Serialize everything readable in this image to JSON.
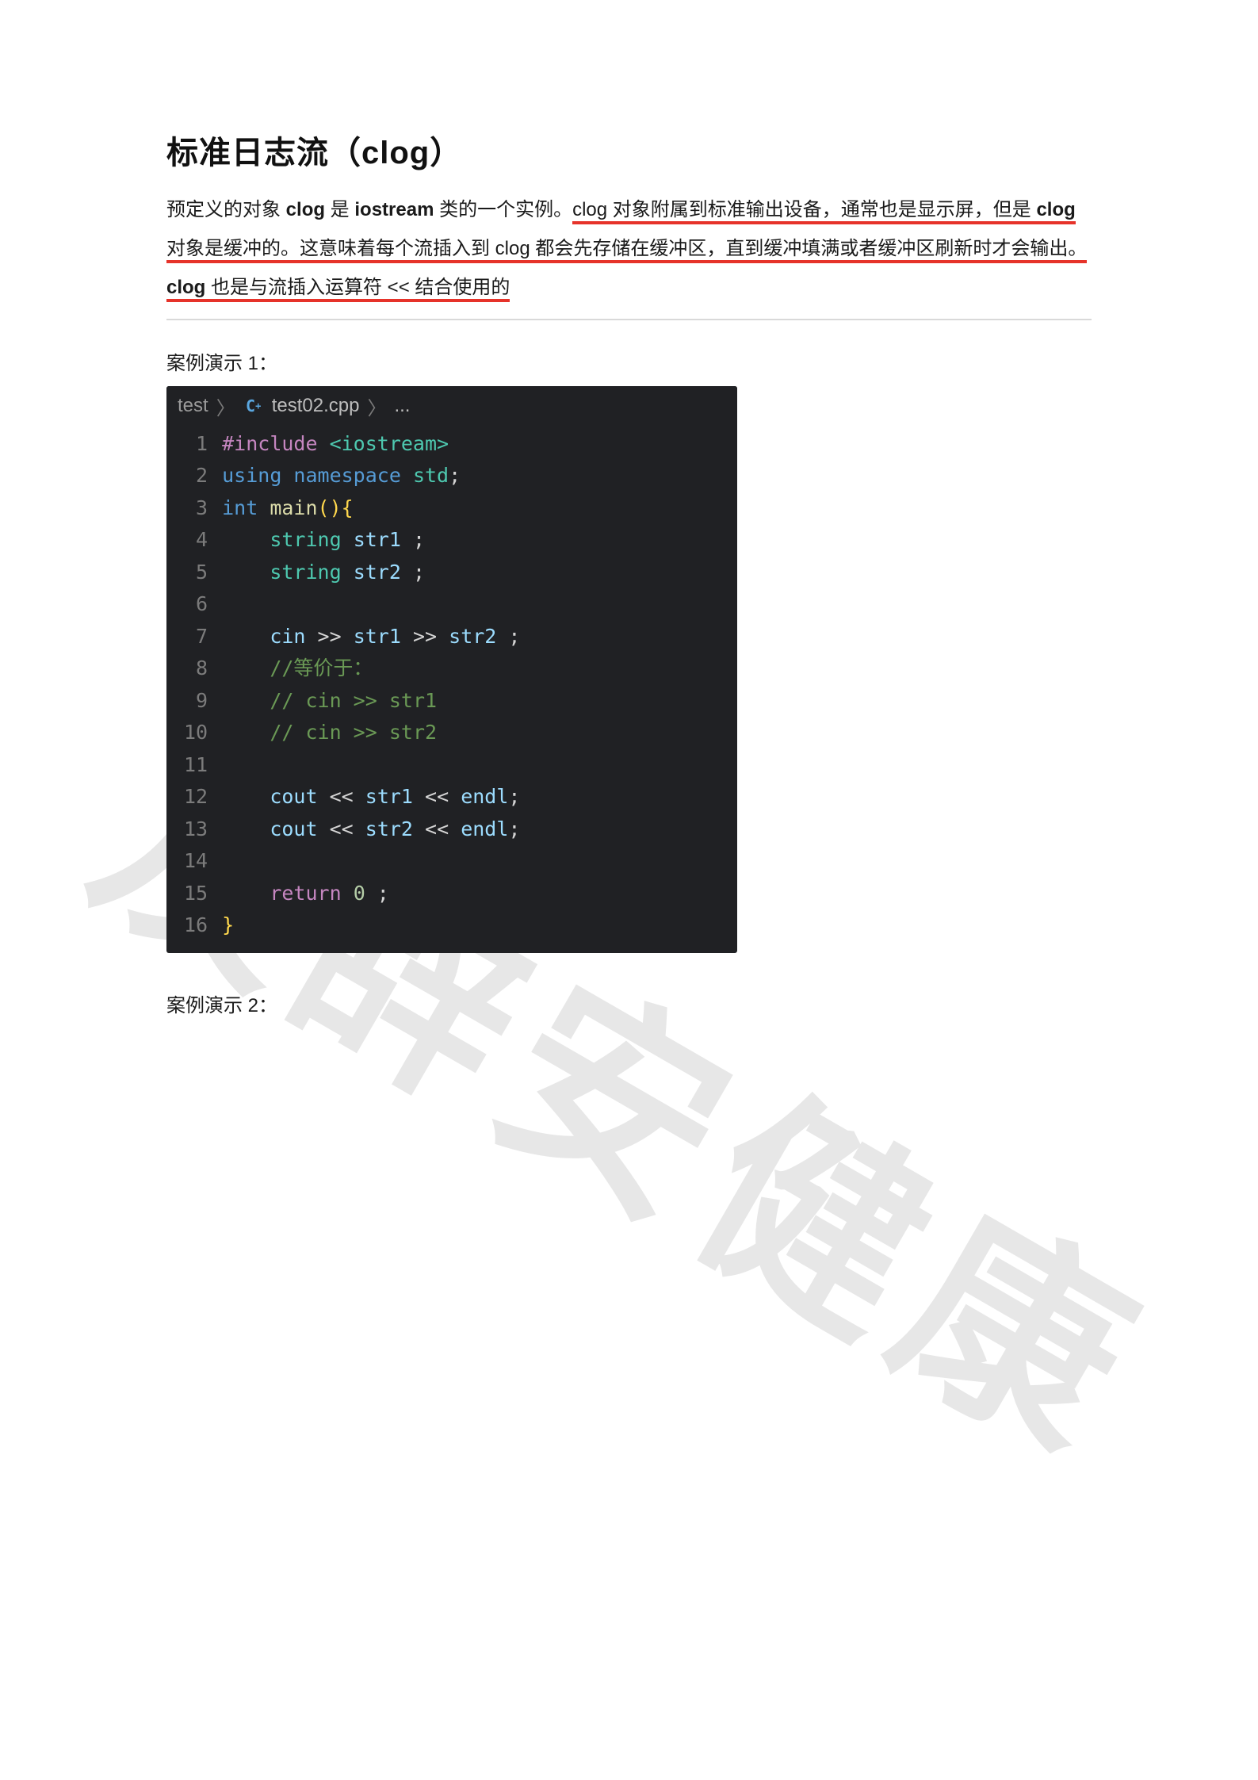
{
  "heading": "标准日志流（clog）",
  "p1a": "预定义的对象 ",
  "p1b": "clog",
  "p1c": " 是 ",
  "p1d": "iostream",
  "p1e": " 类的一个实例。",
  "p1f": "clog 对象附属到标准输出设备，通常也是显示屏，但是 ",
  "p1g": "clog",
  "p1h": " 对象是缓冲的。",
  "p1i": "这意味着每个流插入到 clog 都会先存储在缓冲区，直到缓冲填满或者缓冲区刷新时才会输出。",
  "p2a": "clog",
  "p2b": " 也是与流插入运算符 << 结合使用的",
  "caption1": "案例演示 1：",
  "caption2": "案例演示 2：",
  "watermark": "及辞安健康",
  "editor": {
    "breadcrumb": {
      "folder": "test",
      "file": "test02.cpp",
      "tail": "..."
    },
    "code": {
      "lines": [
        {
          "n": "1",
          "seg": [
            {
              "t": "#include ",
              "c": "mg"
            },
            {
              "t": "<iostream>",
              "c": "gr"
            }
          ]
        },
        {
          "n": "2",
          "seg": [
            {
              "t": "using ",
              "c": "bl"
            },
            {
              "t": "namespace ",
              "c": "bl"
            },
            {
              "t": "std",
              "c": "gr"
            },
            {
              "t": ";",
              "c": "ds"
            }
          ]
        },
        {
          "n": "3",
          "seg": [
            {
              "t": "int ",
              "c": "bl"
            },
            {
              "t": "main",
              "c": "fn"
            },
            {
              "t": "()",
              "c": "yb"
            },
            {
              "t": "{",
              "c": "yb"
            }
          ]
        },
        {
          "n": "4",
          "seg": [
            {
              "t": "    ",
              "c": "ds"
            },
            {
              "t": "string ",
              "c": "gr"
            },
            {
              "t": "str1 ",
              "c": "vr"
            },
            {
              "t": ";",
              "c": "ds"
            }
          ]
        },
        {
          "n": "5",
          "seg": [
            {
              "t": "    ",
              "c": "ds"
            },
            {
              "t": "string ",
              "c": "gr"
            },
            {
              "t": "str2 ",
              "c": "vr"
            },
            {
              "t": ";",
              "c": "ds"
            }
          ]
        },
        {
          "n": "6",
          "seg": [
            {
              "t": " ",
              "c": "ds"
            }
          ]
        },
        {
          "n": "7",
          "seg": [
            {
              "t": "    ",
              "c": "ds"
            },
            {
              "t": "cin",
              "c": "vr"
            },
            {
              "t": " >> ",
              "c": "ds"
            },
            {
              "t": "str1",
              "c": "vr"
            },
            {
              "t": " >> ",
              "c": "ds"
            },
            {
              "t": "str2 ",
              "c": "vr"
            },
            {
              "t": ";",
              "c": "ds"
            }
          ]
        },
        {
          "n": "8",
          "seg": [
            {
              "t": "    ",
              "c": "ds"
            },
            {
              "t": "//等价于：",
              "c": "cm"
            }
          ]
        },
        {
          "n": "9",
          "seg": [
            {
              "t": "    ",
              "c": "ds"
            },
            {
              "t": "// cin >> str1",
              "c": "cm"
            }
          ]
        },
        {
          "n": "10",
          "seg": [
            {
              "t": "    ",
              "c": "ds"
            },
            {
              "t": "// cin >> str2",
              "c": "cm"
            }
          ]
        },
        {
          "n": "11",
          "seg": [
            {
              "t": " ",
              "c": "ds"
            }
          ]
        },
        {
          "n": "12",
          "seg": [
            {
              "t": "    ",
              "c": "ds"
            },
            {
              "t": "cout",
              "c": "vr"
            },
            {
              "t": " << ",
              "c": "ds"
            },
            {
              "t": "str1",
              "c": "vr"
            },
            {
              "t": " << ",
              "c": "ds"
            },
            {
              "t": "endl",
              "c": "vr"
            },
            {
              "t": ";",
              "c": "ds"
            }
          ]
        },
        {
          "n": "13",
          "seg": [
            {
              "t": "    ",
              "c": "ds"
            },
            {
              "t": "cout",
              "c": "vr"
            },
            {
              "t": " << ",
              "c": "ds"
            },
            {
              "t": "str2",
              "c": "vr"
            },
            {
              "t": " << ",
              "c": "ds"
            },
            {
              "t": "endl",
              "c": "vr"
            },
            {
              "t": ";",
              "c": "ds"
            }
          ]
        },
        {
          "n": "14",
          "seg": [
            {
              "t": " ",
              "c": "ds"
            }
          ]
        },
        {
          "n": "15",
          "seg": [
            {
              "t": "    ",
              "c": "ds"
            },
            {
              "t": "return ",
              "c": "mg"
            },
            {
              "t": "0 ",
              "c": "nm"
            },
            {
              "t": ";",
              "c": "ds"
            }
          ]
        },
        {
          "n": "16",
          "seg": [
            {
              "t": "}",
              "c": "yb"
            }
          ]
        }
      ]
    }
  }
}
